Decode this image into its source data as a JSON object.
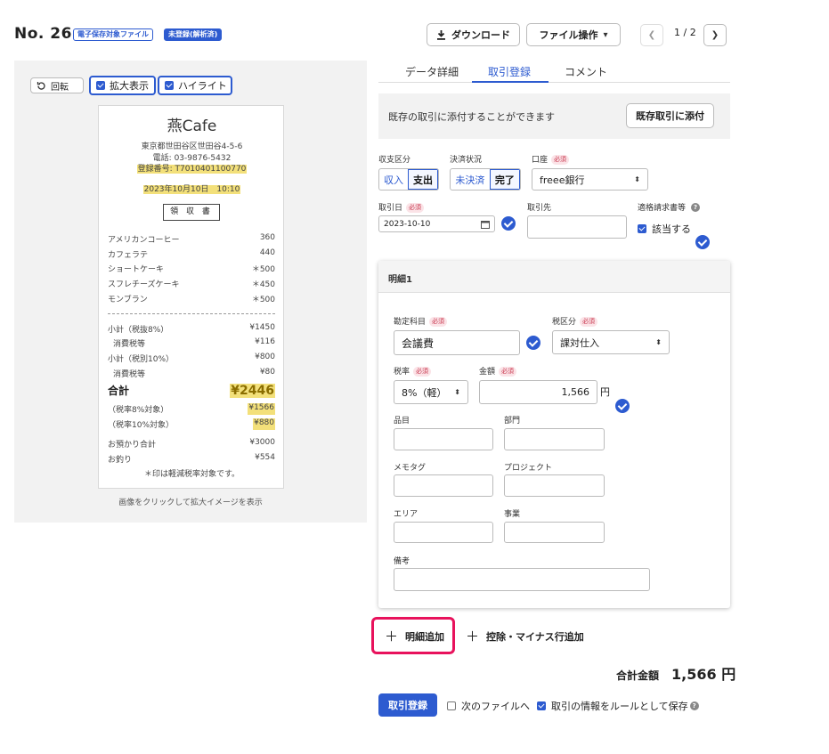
{
  "header": {
    "title": "No. 26",
    "badge_electronic": "電子保存対象ファイル",
    "badge_status": "未登録(解析済)",
    "download_label": "ダウンロード",
    "file_ops_label": "ファイル操作",
    "page_indicator": "1 / 2"
  },
  "image_panel": {
    "rotate_label": "回転",
    "zoom_label": "拡大表示",
    "highlight_label": "ハイライト",
    "caption": "画像をクリックして拡大イメージを表示"
  },
  "receipt": {
    "shop": "燕Cafe",
    "address": "東京都世田谷区世田谷4-5-6",
    "phone": "電話: 03-9876-5432",
    "registration": "登録番号: T7010401100770",
    "date": "2023年10月10日　10:10",
    "doc_type": "領 収 書",
    "items": [
      {
        "name": "アメリカンコーヒー",
        "price": "360"
      },
      {
        "name": "カフェラテ",
        "price": "440"
      },
      {
        "name": "ショートケーキ",
        "price": "＊500"
      },
      {
        "name": "スフレチーズケーキ",
        "price": "＊450"
      },
      {
        "name": "モンブラン",
        "price": "＊500"
      }
    ],
    "subtotal8_label": "小計（税抜8%）",
    "subtotal8": "¥1450",
    "tax8_label": "消費税等",
    "tax8": "¥116",
    "subtotal10_label": "小計（税別10%）",
    "subtotal10": "¥800",
    "tax10_label": "消費税等",
    "tax10": "¥80",
    "total_label": "合計",
    "total": "¥2446",
    "target8_label": "（税率8%対象）",
    "target8": "¥1566",
    "target10_label": "（税率10%対象）",
    "target10": "¥880",
    "deposit_label": "お預かり合計",
    "deposit": "¥3000",
    "change_label": "お釣り",
    "change": "¥554",
    "footnote": "＊印は軽減税率対象です。"
  },
  "tabs": [
    "データ詳細",
    "取引登録",
    "コメント"
  ],
  "notice": {
    "text": "既存の取引に添付することができます",
    "button": "既存取引に添付"
  },
  "form": {
    "required": "必須",
    "income_type_label": "収支区分",
    "income_options": [
      "収入",
      "支出"
    ],
    "settle_label": "決済状況",
    "settle_options": [
      "未決済",
      "完了"
    ],
    "account_label": "口座",
    "account_value": "freee銀行",
    "date_label": "取引日",
    "date_value": "2023-10-10",
    "partner_label": "取引先",
    "qualified_label": "適格請求書等",
    "qualified_check": "該当する"
  },
  "detail": {
    "header": "明細1",
    "account_item_label": "勘定科目",
    "account_item_value": "会議費",
    "tax_class_label": "税区分",
    "tax_class_value": "課対仕入",
    "tax_rate_label": "税率",
    "tax_rate_value": "8%（軽）",
    "amount_label": "金額",
    "amount_value": "1,566",
    "yen": "円",
    "item_label": "品目",
    "dept_label": "部門",
    "memo_label": "メモタグ",
    "project_label": "プロジェクト",
    "area_label": "エリア",
    "business_label": "事業",
    "remarks_label": "備考"
  },
  "actions": {
    "add_line": "明細追加",
    "add_deduction": "控除・マイナス行追加",
    "total_label": "合計金額",
    "total_value": "1,566 円",
    "submit": "取引登録",
    "next_file": "次のファイルへ",
    "save_rule": "取引の情報をルールとして保存"
  },
  "colors": {
    "accent": "#2d5bd0",
    "highlight_frame": "#e8125c",
    "receipt_highlight": "#f3e07a"
  }
}
